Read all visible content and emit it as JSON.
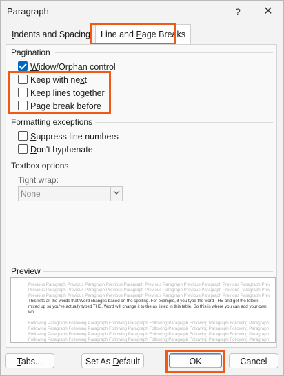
{
  "window": {
    "title": "Paragraph",
    "help_glyph": "?",
    "close_glyph": "✕"
  },
  "tabs": [
    {
      "label": "Indents and Spacing",
      "active": false
    },
    {
      "label": "Line and Page Breaks",
      "active": true
    }
  ],
  "pagination": {
    "label": "Pagination",
    "items": [
      {
        "pre": "",
        "u": "W",
        "post": "idow/Orphan control",
        "checked": true
      },
      {
        "pre": "Keep with ne",
        "u": "x",
        "post": "t",
        "checked": false
      },
      {
        "pre": "",
        "u": "K",
        "post": "eep lines together",
        "checked": false
      },
      {
        "pre": "Page ",
        "u": "b",
        "post": "reak before",
        "checked": false
      }
    ]
  },
  "formatting": {
    "label": "Formatting exceptions",
    "items": [
      {
        "pre": "",
        "u": "S",
        "post": "uppress line numbers",
        "checked": false
      },
      {
        "pre": "",
        "u": "D",
        "post": "on't hyphenate",
        "checked": false
      }
    ]
  },
  "textbox": {
    "label": "Textbox options",
    "tight_wrap_pre": "Tight w",
    "tight_wrap_u": "r",
    "tight_wrap_post": "ap:",
    "select_value": "None",
    "select_icon": "chevron-down-icon"
  },
  "preview": {
    "label": "Preview",
    "prev_line": "Previous Paragraph Previous Paragraph Previous Paragraph Previous Paragraph Previous Paragraph Previous Paragraph Previous Paragraph",
    "body_text": "This lists all the words that Word changes based on the spelling. For example, if you type the word THE and get the letters mixed up so you've actually typed THE, Word will change it to the as listed in this table. So this is where you can add your own wo",
    "follow_line": "Following Paragraph Following Paragraph Following Paragraph Following Paragraph Following Paragraph Following Paragraph Following Paragraph"
  },
  "buttons": {
    "tabs_u": "T",
    "tabs_post": "abs...",
    "default_pre": "Set As ",
    "default_u": "D",
    "default_post": "efault",
    "ok": "OK",
    "cancel": "Cancel"
  },
  "colors": {
    "highlight": "#f05a14",
    "checkbox_checked": "#0067c0"
  }
}
